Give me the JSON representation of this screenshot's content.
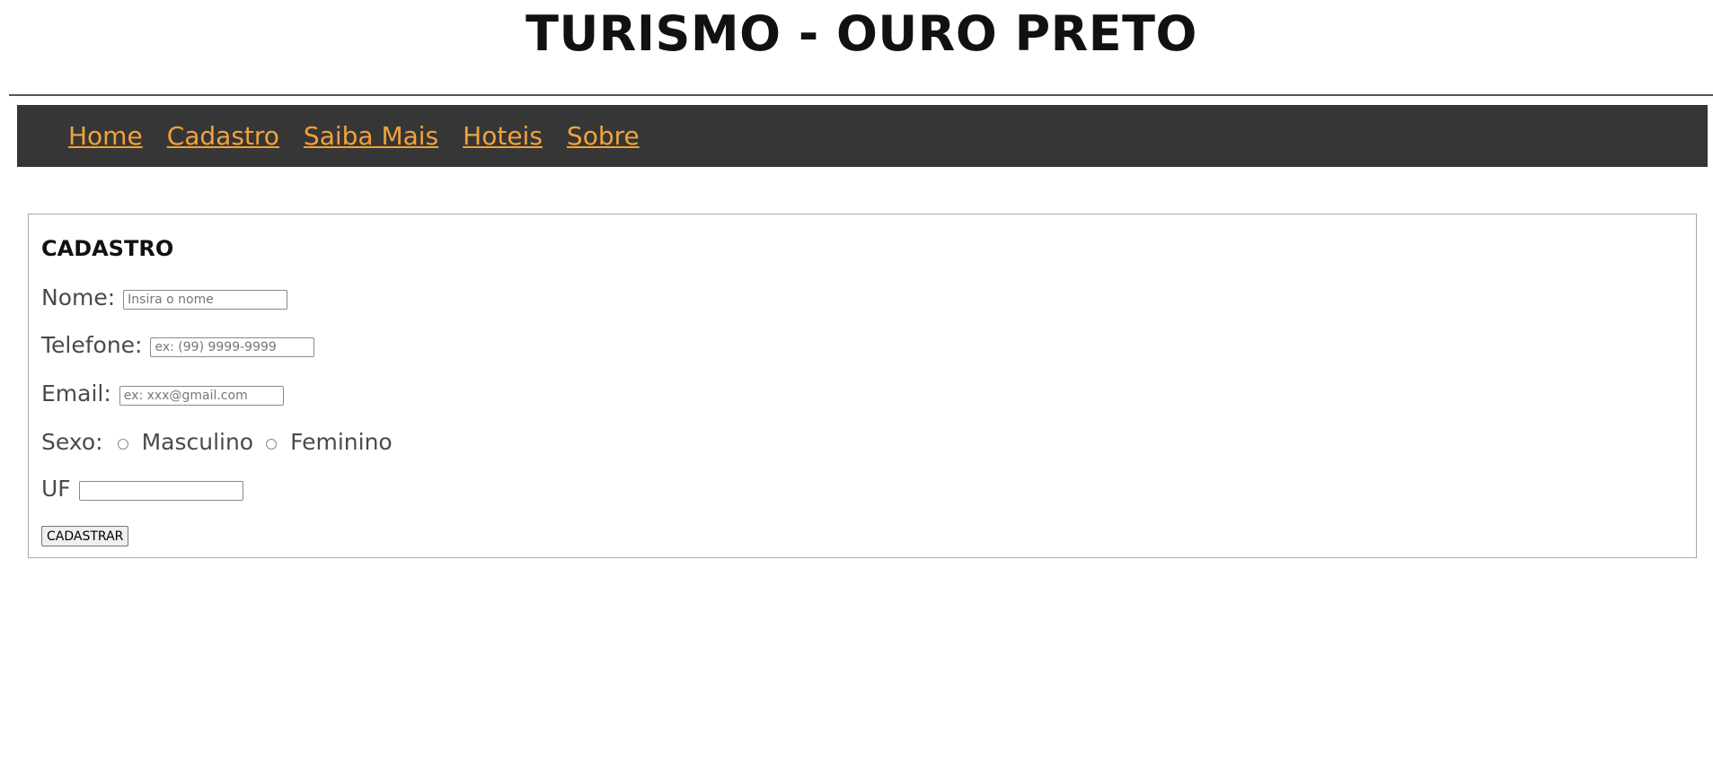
{
  "header": {
    "title": "TURISMO - OURO PRETO"
  },
  "nav": {
    "items": [
      {
        "label": "Home"
      },
      {
        "label": "Cadastro"
      },
      {
        "label": "Saiba Mais"
      },
      {
        "label": "Hoteis"
      },
      {
        "label": "Sobre"
      }
    ],
    "background_color": "#363636",
    "link_color": "#f0a33a"
  },
  "form": {
    "heading": "CADASTRO",
    "nome": {
      "label": "Nome:",
      "placeholder": "Insira o nome",
      "value": ""
    },
    "telefone": {
      "label": "Telefone:",
      "placeholder": "ex: (99) 9999-9999",
      "value": ""
    },
    "email": {
      "label": "Email:",
      "placeholder": "ex: xxx@gmail.com",
      "value": ""
    },
    "sexo": {
      "label": "Sexo:",
      "options": [
        {
          "label": "Masculino",
          "checked": false
        },
        {
          "label": "Feminino",
          "checked": false
        }
      ]
    },
    "uf": {
      "label": "UF",
      "placeholder": "",
      "value": ""
    },
    "submit_label": "CADASTRAR"
  }
}
